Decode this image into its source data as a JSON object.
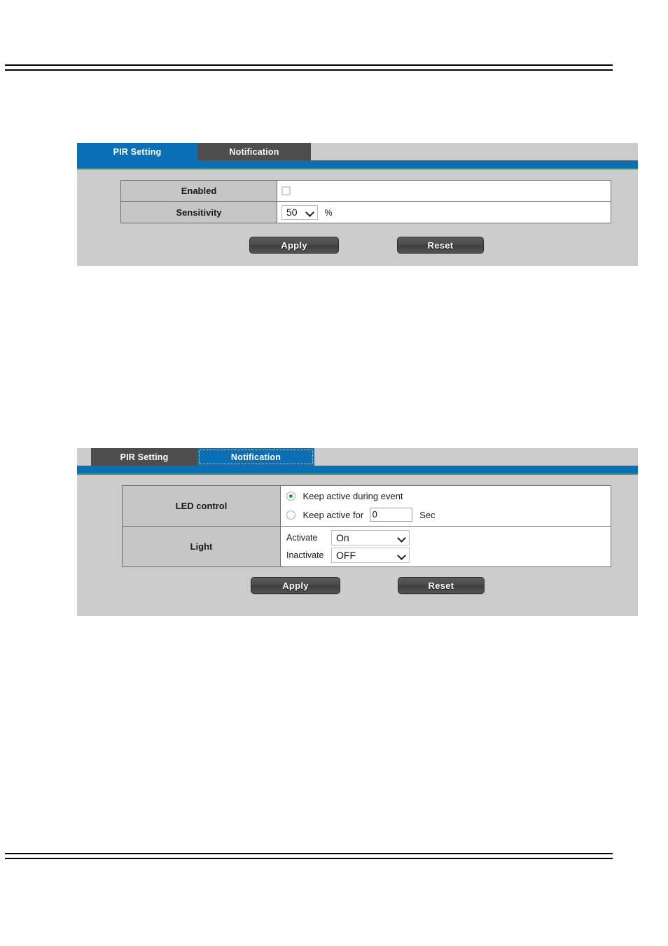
{
  "rules": {
    "top": "horizontal-rule",
    "bottom": "horizontal-rule"
  },
  "pir_panel": {
    "tabs": [
      {
        "label": "PIR Setting",
        "active": true
      },
      {
        "label": "Notification",
        "active": false
      }
    ],
    "rows": [
      {
        "label": "Enabled",
        "control": "checkbox",
        "checked": false
      },
      {
        "label": "Sensitivity",
        "control": "select",
        "value": "50",
        "suffix": "%"
      }
    ],
    "buttons": {
      "apply": "Apply",
      "reset": "Reset"
    }
  },
  "notification_panel": {
    "tabs": [
      {
        "label": "PIR Setting",
        "active": false
      },
      {
        "label": "Notification",
        "active": true
      }
    ],
    "led_control": {
      "label": "LED control",
      "option_during_event": "Keep active during event",
      "option_keep_active_for": "Keep active for",
      "duration_value": "0",
      "duration_unit": "Sec",
      "selected": "during_event"
    },
    "light": {
      "label": "Light",
      "activate_label": "Activate",
      "activate_value": "On",
      "inactivate_label": "Inactivate",
      "inactivate_value": "OFF"
    },
    "buttons": {
      "apply": "Apply",
      "reset": "Reset"
    }
  },
  "colors": {
    "tab_active": "#0a6fb5",
    "tab_inactive": "#4d4d4d",
    "panel_bg": "#cccccc",
    "label_cell_bg": "#c6c6c6",
    "accent_underline": "#3d8f7f",
    "radio_dot": "#2aa02a"
  }
}
